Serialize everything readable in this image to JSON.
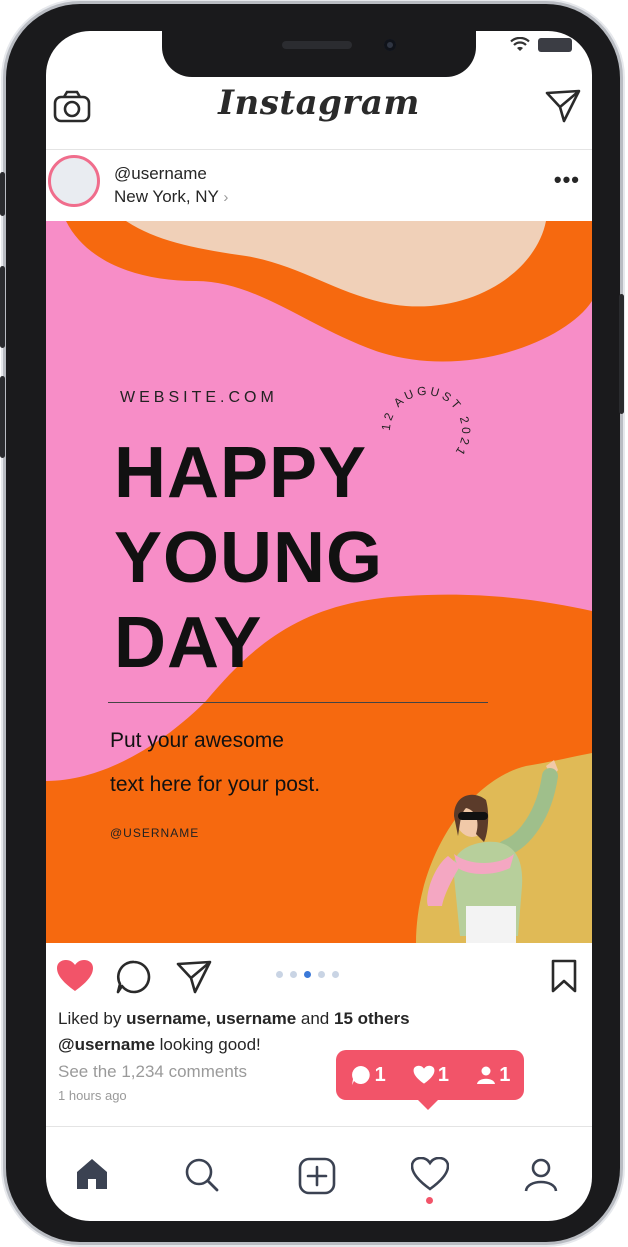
{
  "app": {
    "title": "Instagram"
  },
  "status_bar": {
    "wifi_icon": "wifi-icon",
    "battery_icon": "battery-icon"
  },
  "post": {
    "username": "@username",
    "location": "New York, NY",
    "location_chevron": "›",
    "more_icon": "•••",
    "image": {
      "website": "WEBSITE.COM",
      "headline": [
        "HAPPY",
        "YOUNG",
        "DAY"
      ],
      "stamp_text": "12 AUGUST 2021",
      "body_lines": [
        "Put your awesome",
        "text here for your post."
      ],
      "handle": "@USERNAME",
      "colors": {
        "background": "#f78dc7",
        "orange": "#f6690f",
        "peach": "#f0d0b8",
        "mustard": "#e0ba56"
      }
    },
    "carousel": {
      "count": 5,
      "active_index": 2
    },
    "liked_prefix": "Liked by",
    "liked_names": "username, username",
    "liked_and": "and",
    "liked_others": "15 others",
    "caption_user": "@username",
    "caption_text": "looking good!",
    "comments_link": "See the 1,234 comments",
    "time_ago": "1 hours ago"
  },
  "notification": {
    "comments": "1",
    "likes": "1",
    "followers": "1"
  },
  "colors": {
    "accent": "#f25469",
    "text": "#262626",
    "muted": "#9a9a9a",
    "active_dot": "#3b79d8"
  },
  "tabbar": {
    "active_indicator": "likes"
  }
}
